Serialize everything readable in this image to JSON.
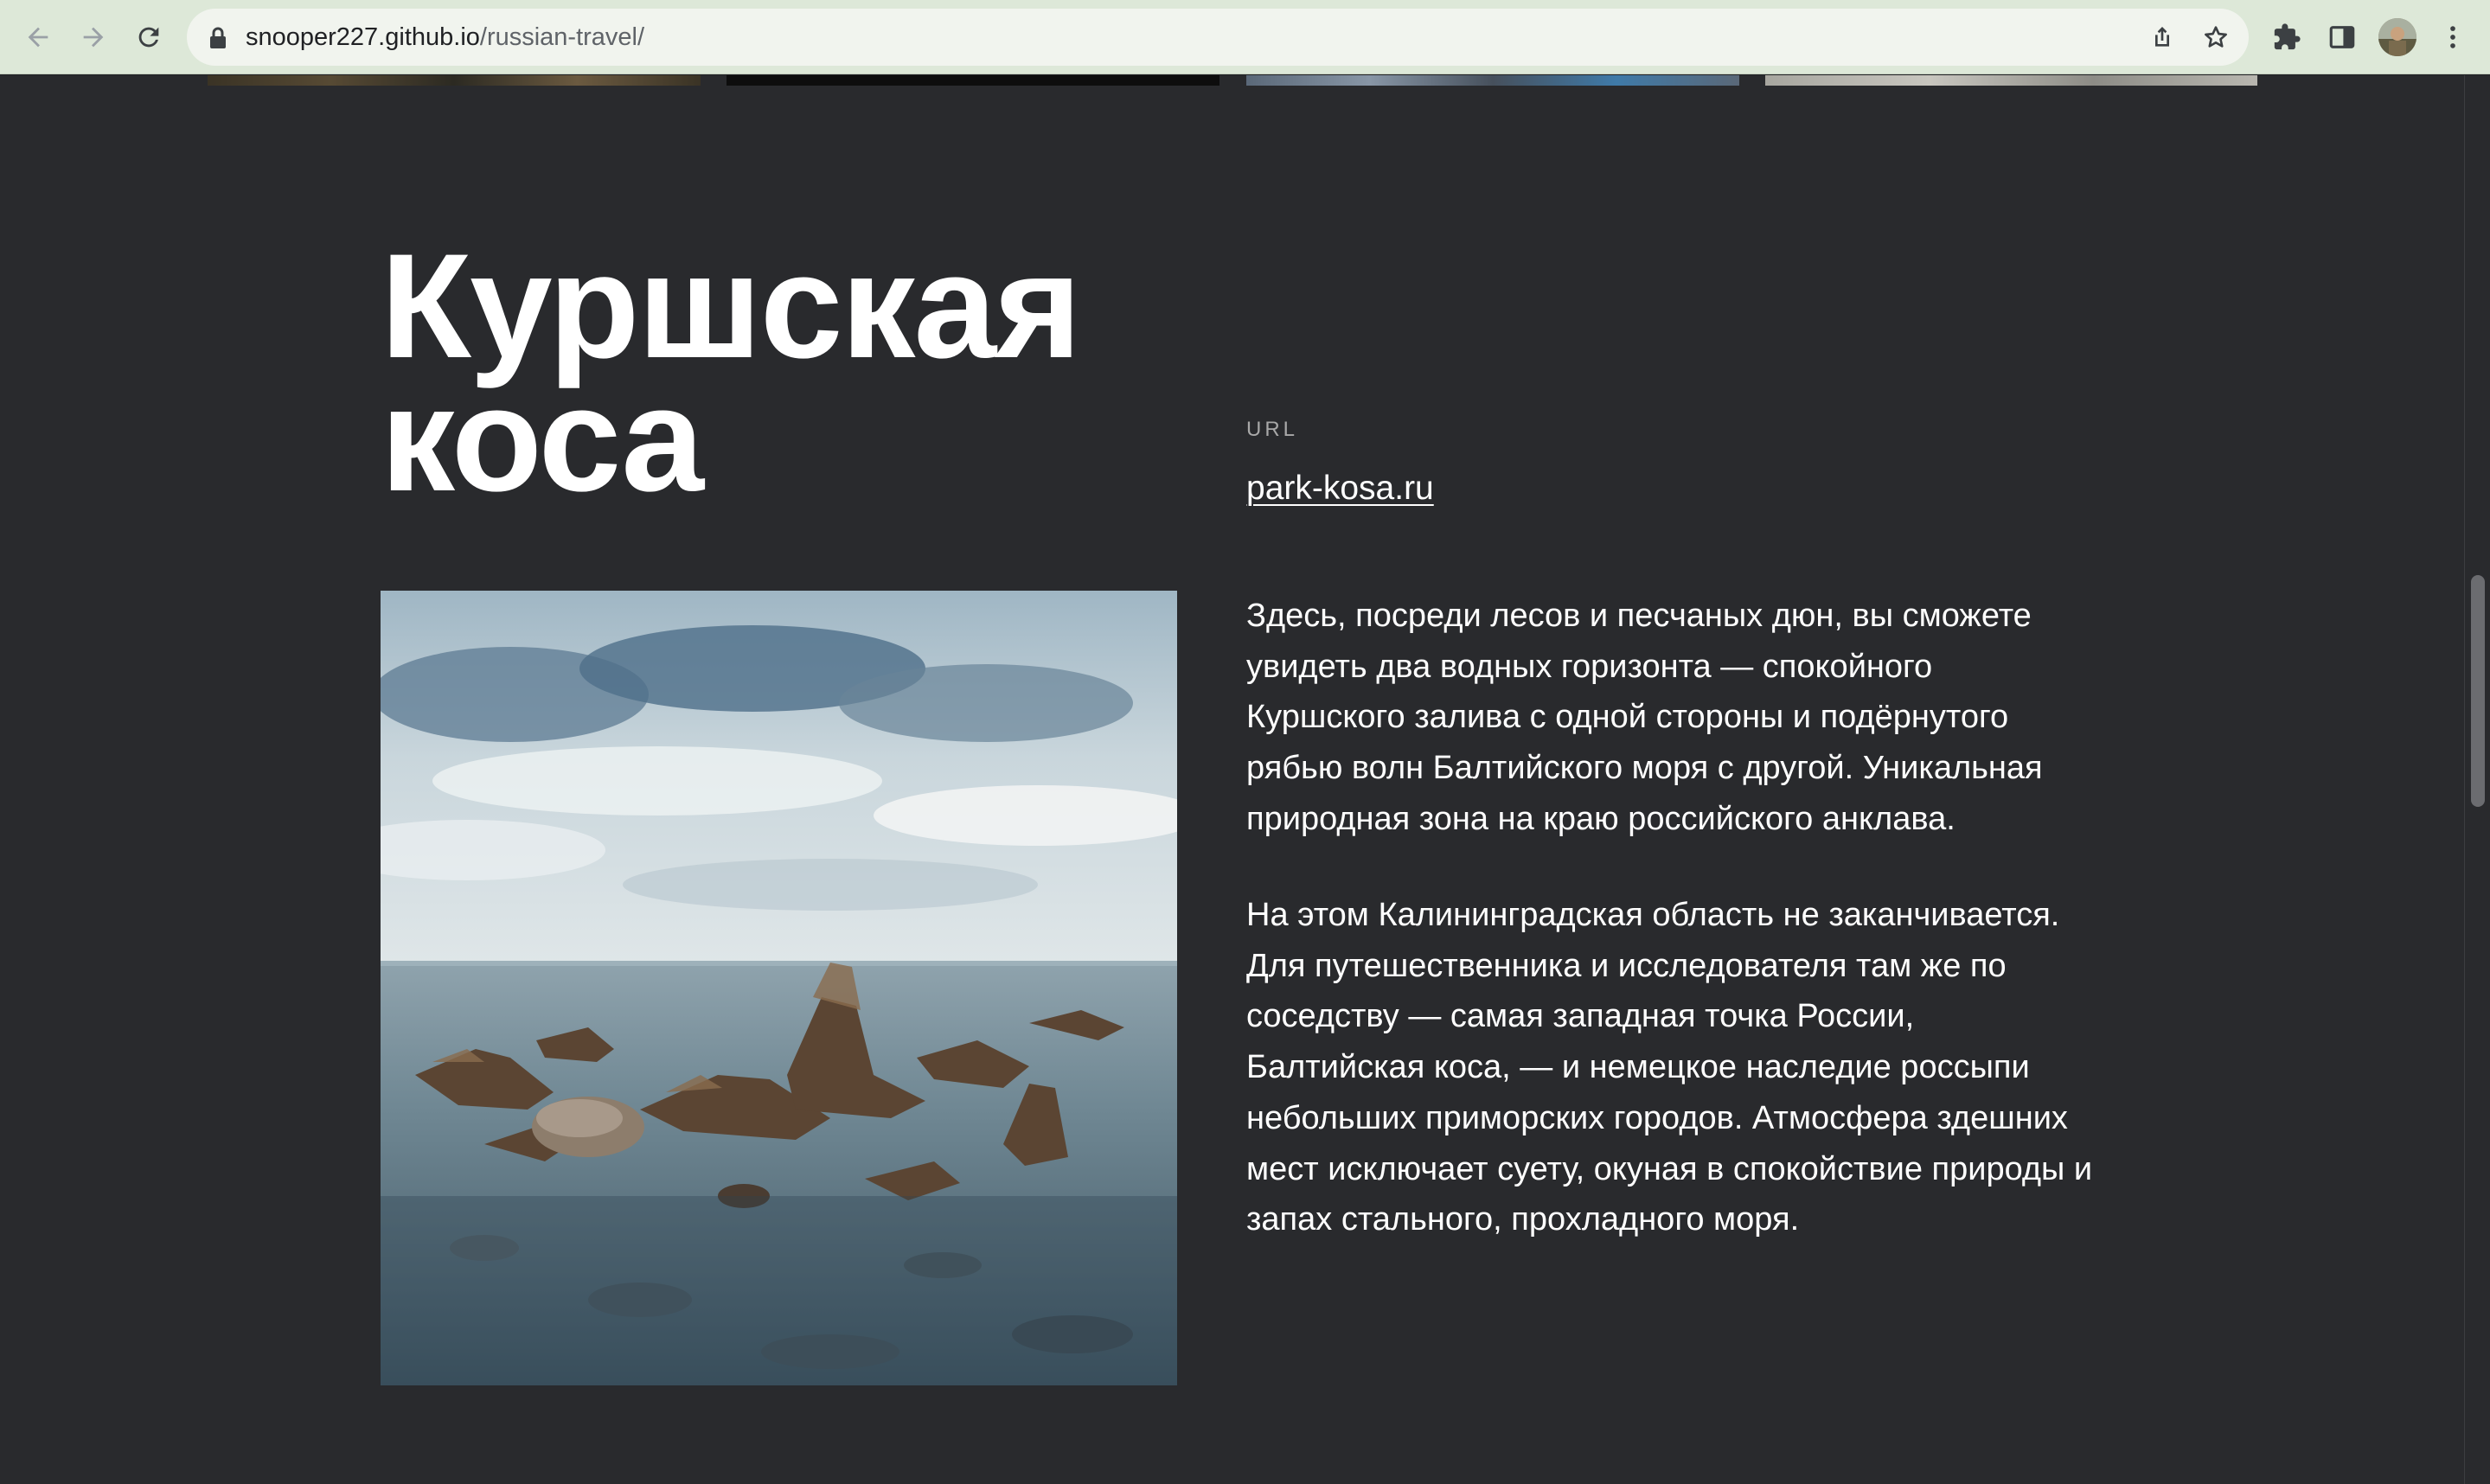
{
  "browser": {
    "url_host": "snooper227.github.io",
    "url_path": "/russian-travel/",
    "icons": [
      "back-arrow-icon",
      "forward-arrow-icon",
      "reload-icon",
      "lock-icon",
      "share-icon",
      "bookmark-star-icon",
      "extensions-puzzle-icon",
      "side-panel-icon",
      "profile-avatar",
      "menu-kebab-icon"
    ]
  },
  "section": {
    "title_line1": "Куршская",
    "title_line2": "коса",
    "url_label": "URL",
    "url_link": "park-kosa.ru",
    "paragraph1": "Здесь, посреди лесов и песчаных дюн, вы сможете увидеть два водных горизонта — спокойного Куршского залива с одной стороны и подёрнутого рябью волн Балтийского моря с другой. Уникальная природная зона на краю российского анклава.",
    "paragraph2": "На этом Калининградская область не заканчивается. Для путешественника и исследователя там же по соседству — самая западная точка России, Балтийская коса, — и немецкое наследие россыпи небольших приморских городов. Атмосфера здешних мест исключает суету, окуная в спокойствие природы и запах стального, прохладного моря."
  },
  "colors": {
    "page_background": "#292a2d",
    "toolbar_background": "#dde8d8",
    "text": "#ffffff",
    "label": "#a8a8a8"
  }
}
